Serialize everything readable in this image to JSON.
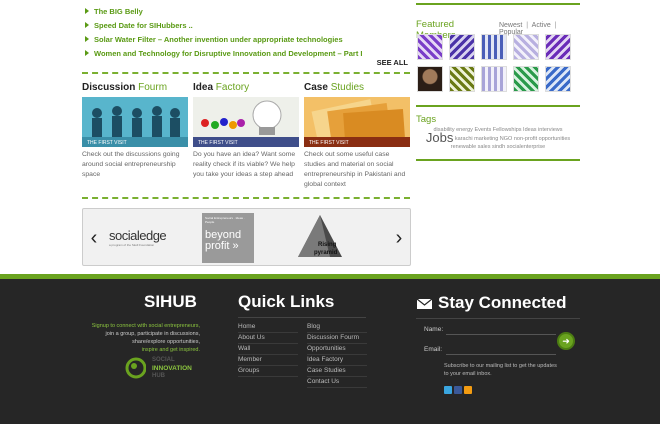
{
  "posts": [
    "The BIG Belly",
    "Speed Date for SIHubbers ..",
    "Solar Water Filter – Another invention under appropriate technologies",
    "Women and Technology for Disruptive Innovation and Development – Part I"
  ],
  "see_all": "SEE ALL",
  "columns": [
    {
      "title_a": "Discussion",
      "title_b": "Fourm",
      "badge": "THE FIRST VISIT",
      "text": "Check out the discussions going around social entrepreneurship space"
    },
    {
      "title_a": "Idea",
      "title_b": "Factory",
      "badge": "THE FIRST VISIT",
      "text": "Do you have an idea? Want some reality check if its viable? We help you take your ideas a step ahead"
    },
    {
      "title_a": "Case",
      "title_b": "Studies",
      "badge": "THE FIRST VISIT",
      "text": "Check out some useful case studies and material on social entrepreneurship in Pakistani and global context"
    }
  ],
  "slider": {
    "prev_icon": "chevron-left-icon",
    "next_icon": "chevron-right-icon",
    "logos": {
      "socialedge": "socialedge",
      "socialedge_sub": "a program of the Skoll Foundation",
      "beyondprofit_top": "Social Entrepreneurs · Ideas · People",
      "beyondprofit_1": "beyond",
      "beyondprofit_2": "profit »",
      "rising_1": "Rising",
      "rising_2": "pyramid"
    }
  },
  "sidebar": {
    "featured_title": "Featured Members",
    "filters": [
      "Newest",
      "Active",
      "Popular"
    ],
    "filter_sep": "|",
    "tags_title": "Tags",
    "tags_line1": "disability energy Events Fellowships Ideas interviews",
    "tags_big": "Jobs",
    "tags_line2": "karachi marketing NGO non-profit opportunities",
    "tags_line3": "renewable sales sindh socialenterprise"
  },
  "footer": {
    "sihub_title": "SIHUB",
    "signup_green": "Signup to connect with social entrepreneurs,",
    "signup_1": "join a group, participate in discussions,",
    "signup_2": "share/explore opportunities,",
    "signup_green2": "inspire and get inspired.",
    "logo_top": "SOCIAL",
    "logo_mid": "INNOVATION",
    "logo_bottom": "HUB",
    "quick_links_title": "Quick Links",
    "links_left": [
      "Home",
      "About Us",
      "Wall",
      "Member",
      "Groups"
    ],
    "links_right": [
      "Blog",
      "Discussion Fourm",
      "Opportunities",
      "Idea Factory",
      "Case Studies",
      "Contact Us"
    ],
    "stay_title": "Stay Connected",
    "name_label": "Name:",
    "email_label": "Email:",
    "subscribe_text": "Subscribe to our mailing list to get the updates to your email inbox.",
    "social_icons": [
      "twitter-icon",
      "facebook-icon",
      "rss-icon"
    ]
  },
  "colors": {
    "brand_green": "#6aa31f",
    "footer_bg": "#262626"
  }
}
